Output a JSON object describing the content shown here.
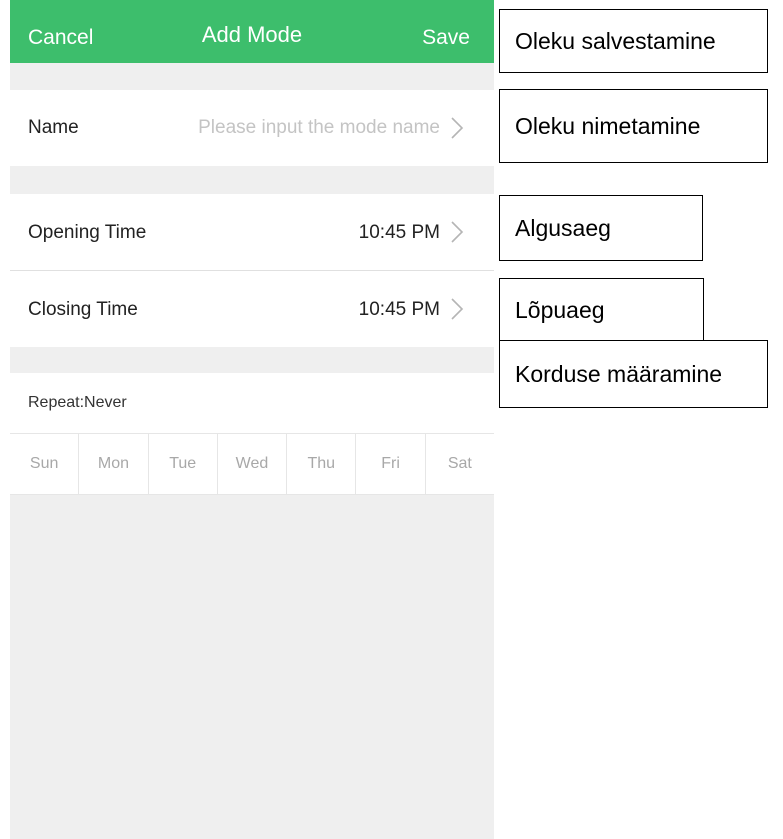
{
  "navbar": {
    "cancel_label": "Cancel",
    "title": "Add Mode",
    "save_label": "Save",
    "color": "#3dbe6c"
  },
  "name_row": {
    "label": "Name",
    "placeholder": "Please input the mode name"
  },
  "opening_row": {
    "label": "Opening Time",
    "value": "10:45 PM"
  },
  "closing_row": {
    "label": "Closing Time",
    "value": "10:45 PM"
  },
  "repeat": {
    "label": "Repeat:Never",
    "days": [
      "Sun",
      "Mon",
      "Tue",
      "Wed",
      "Thu",
      "Fri",
      "Sat"
    ]
  },
  "annotations": {
    "save": "Oleku salvestamine",
    "name": "Oleku nimetamine",
    "opening": "Algusaeg",
    "closing": "Lõpuaeg",
    "repeat": "Korduse määramine"
  },
  "icons": {
    "row_chevron": "chevron-right-icon"
  }
}
